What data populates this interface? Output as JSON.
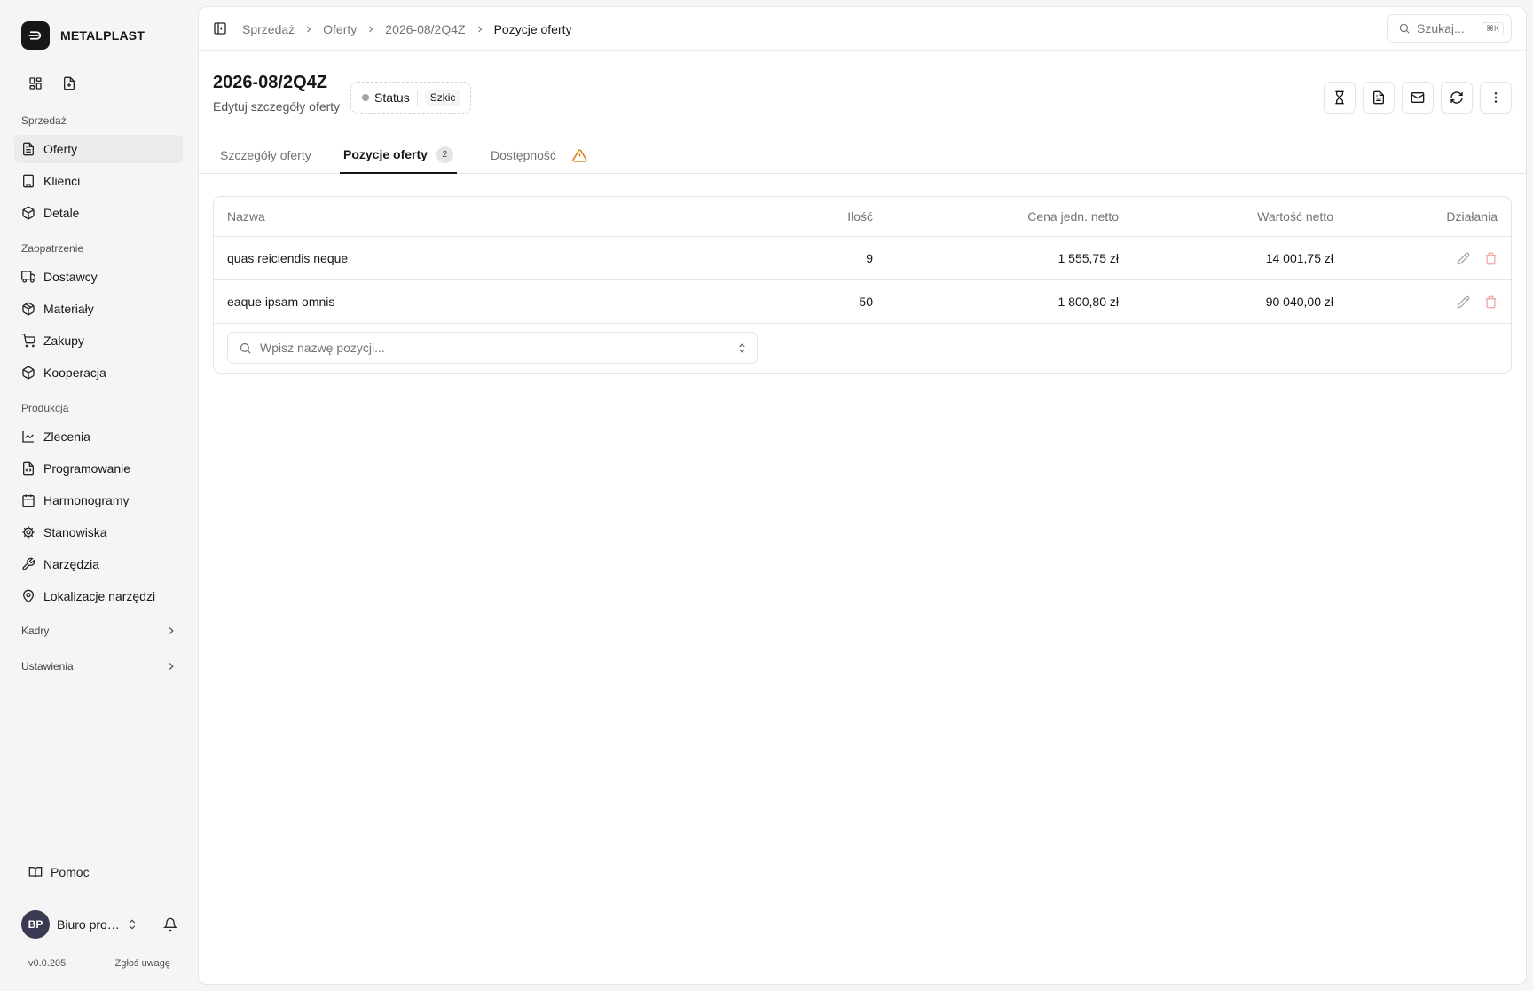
{
  "brand": {
    "name": "METALPLAST"
  },
  "sidebar": {
    "sections": [
      {
        "label": "Sprzedaż"
      },
      {
        "label": "Zaopatrzenie"
      },
      {
        "label": "Produkcja"
      }
    ],
    "items": [
      {
        "label": "Oferty",
        "icon": "file-text-icon",
        "active": true
      },
      {
        "label": "Klienci",
        "icon": "building-icon"
      },
      {
        "label": "Detale",
        "icon": "box-icon"
      },
      {
        "label": "Dostawcy",
        "icon": "truck-icon"
      },
      {
        "label": "Materiały",
        "icon": "package-icon"
      },
      {
        "label": "Zakupy",
        "icon": "cart-icon"
      },
      {
        "label": "Kooperacja",
        "icon": "cube-icon"
      },
      {
        "label": "Zlecenia",
        "icon": "chart-icon"
      },
      {
        "label": "Programowanie",
        "icon": "file-code-icon"
      },
      {
        "label": "Harmonogramy",
        "icon": "calendar-icon"
      },
      {
        "label": "Stanowiska",
        "icon": "cog-icon"
      },
      {
        "label": "Narzędzia",
        "icon": "wrench-icon"
      },
      {
        "label": "Lokalizacje narzędzi",
        "icon": "map-pin-icon"
      }
    ],
    "collapsibles": [
      {
        "label": "Kadry"
      },
      {
        "label": "Ustawienia"
      }
    ],
    "help_label": "Pomoc",
    "user": {
      "initials": "BP",
      "name": "Biuro pro…"
    },
    "version": "v0.0.205",
    "feedback_label": "Zgłoś uwagę"
  },
  "topbar": {
    "breadcrumb": [
      "Sprzedaż",
      "Oferty",
      "2026-08/2Q4Z",
      "Pozycje oferty"
    ],
    "search_placeholder": "Szukaj...",
    "search_shortcut": "⌘K"
  },
  "header": {
    "title": "2026-08/2Q4Z",
    "subtitle": "Edytuj szczegóły oferty",
    "status_label": "Status",
    "status_value": "Szkic"
  },
  "tabs": [
    {
      "label": "Szczegóły oferty"
    },
    {
      "label": "Pozycje oferty",
      "badge": "2",
      "active": true
    },
    {
      "label": "Dostępność"
    }
  ],
  "table": {
    "columns": [
      "Nazwa",
      "Ilość",
      "Cena jedn. netto",
      "Wartość netto",
      "Działania"
    ],
    "rows": [
      {
        "name": "quas reiciendis neque",
        "qty": "9",
        "unit_price": "1 555,75 zł",
        "value": "14 001,75 zł"
      },
      {
        "name": "eaque ipsam omnis",
        "qty": "50",
        "unit_price": "1 800,80 zł",
        "value": "90 040,00 zł"
      }
    ],
    "add_placeholder": "Wpisz nazwę pozycji..."
  },
  "colors": {
    "accent": "#171717",
    "warning": "#d97706",
    "delete": "#f0a3a3",
    "avatar": "#3a3a52"
  }
}
